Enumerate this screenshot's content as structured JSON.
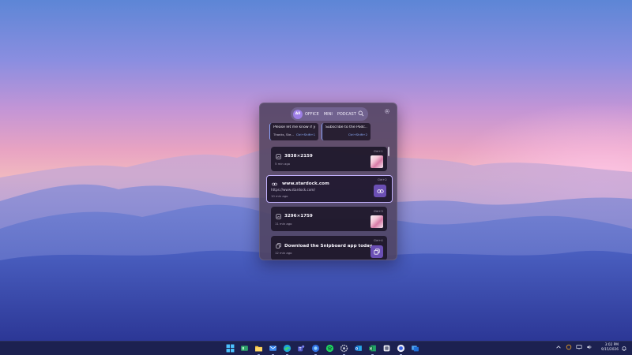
{
  "panel": {
    "tabs": {
      "all": "All",
      "office": "OFFICE",
      "mini": "MINI",
      "podcast": "PODCAST"
    },
    "pinned": [
      {
        "title": "Please let me know if y...",
        "subtitle": "Thanks, Ste...",
        "shortcut": "Ctrl+Shift+1"
      },
      {
        "title": "Subscribe to the Podc...",
        "subtitle": "",
        "shortcut": "Ctrl+Shift+2"
      }
    ],
    "clips": [
      {
        "type": "image",
        "title": "3838×2159",
        "time": "5 min ago",
        "shortcut": "Ctrl+1",
        "icon": "image-icon"
      },
      {
        "type": "link",
        "title": "www.stardock.com",
        "url": "https://www.stardock.com/",
        "time": "10 min ago",
        "shortcut": "Ctrl+2",
        "icon": "link-icon",
        "selected": true
      },
      {
        "type": "image",
        "title": "3296×1759",
        "time": "11 min ago",
        "shortcut": "Ctrl+3",
        "icon": "image-icon"
      },
      {
        "type": "text",
        "title": "Download the Snipboard app today",
        "time": "12 min ago",
        "shortcut": "Ctrl+4",
        "icon": "copy-icon"
      }
    ]
  },
  "taskbar": {
    "apps": [
      "start-icon",
      "widgets-icon",
      "file-explorer-icon",
      "mail-icon",
      "edge-icon",
      "teams-icon",
      "browser-icon",
      "spotify-icon",
      "settings-icon",
      "outlook-icon",
      "excel-icon",
      "app-icon",
      "chrome-icon",
      "windows-app-icon"
    ],
    "time": "3:02 PM",
    "date": "9/15/2026"
  },
  "colors": {
    "accent": "#9d7ee6",
    "selected_border": "#c4b3ff",
    "taskbar": "#1c2150"
  }
}
